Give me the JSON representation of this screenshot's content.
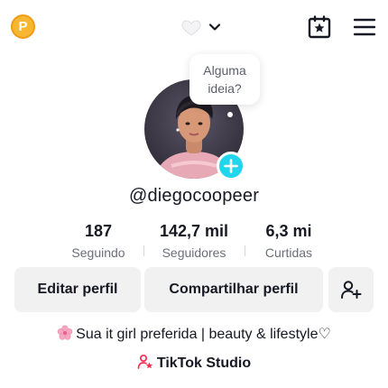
{
  "header": {
    "coin_letter": "P",
    "icons": {
      "coin": "coin-icon",
      "heart": "white-heart-icon",
      "chevron": "chevron-down-icon",
      "calendar": "calendar-star-icon",
      "menu": "hamburger-menu-icon"
    }
  },
  "bubble": {
    "line1": "Alguma",
    "line2": "ideia?"
  },
  "profile": {
    "username": "@diegocoopeer",
    "accent_color": "#20d5ec"
  },
  "stats": [
    {
      "value": "187",
      "label": "Seguindo"
    },
    {
      "value": "142,7 mil",
      "label": "Seguidores"
    },
    {
      "value": "6,3 mi",
      "label": "Curtidas"
    }
  ],
  "actions": {
    "edit_label": "Editar perfil",
    "share_label": "Compartilhar perfil",
    "add_friend_icon": "add-friend-icon"
  },
  "bio": {
    "text": "Sua it girl preferida | beauty & lifestyle♡",
    "emoji_icon": "cherry-blossom-icon"
  },
  "studio": {
    "label": "TikTok Studio",
    "icon": "person-star-icon"
  }
}
